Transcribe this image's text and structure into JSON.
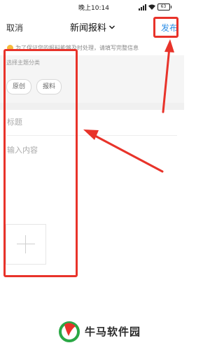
{
  "status_bar": {
    "time": "晚上10:14",
    "battery": "63"
  },
  "nav": {
    "cancel": "取消",
    "title": "新闻报料",
    "publish": "发布"
  },
  "notice": {
    "text": "为了保证您的报料能够及时处理，请填写完整信息"
  },
  "topic": {
    "label": "选择主题分类",
    "chips": [
      "原创",
      "报料"
    ]
  },
  "form": {
    "title_placeholder": "标题",
    "content_placeholder": "输入内容"
  },
  "watermark": {
    "text": "牛马软件园"
  },
  "colors": {
    "accent": "#2f8fe6",
    "highlight": "#e8332a"
  }
}
